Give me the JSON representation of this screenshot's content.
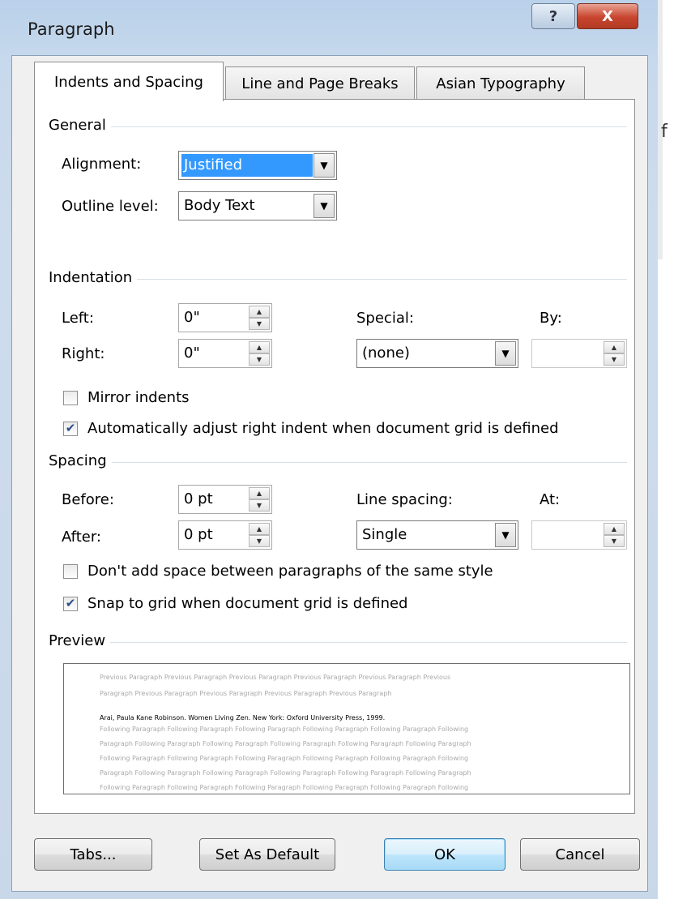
{
  "window": {
    "title": "Paragraph",
    "help_glyph": "?",
    "close_glyph": "X",
    "behind_text": "f"
  },
  "tabs": [
    {
      "label": "Indents and Spacing",
      "active": true
    },
    {
      "label": "Line and Page Breaks",
      "active": false
    },
    {
      "label": "Asian Typography",
      "active": false
    }
  ],
  "general": {
    "section_label": "General",
    "alignment_label": "Alignment:",
    "alignment_value": "Justified",
    "outline_label": "Outline level:",
    "outline_value": "Body Text"
  },
  "indentation": {
    "section_label": "Indentation",
    "left_label": "Left:",
    "left_value": "0\"",
    "right_label": "Right:",
    "right_value": "0\"",
    "special_label": "Special:",
    "special_value": "(none)",
    "by_label": "By:",
    "by_value": "",
    "mirror_label": "Mirror indents",
    "mirror_checked": false,
    "auto_adjust_label": "Automatically adjust right indent when document grid is defined",
    "auto_adjust_checked": true
  },
  "spacing": {
    "section_label": "Spacing",
    "before_label": "Before:",
    "before_value": "0 pt",
    "after_label": "After:",
    "after_value": "0 pt",
    "line_spacing_label": "Line spacing:",
    "line_spacing_value": "Single",
    "at_label": "At:",
    "at_value": "",
    "dont_add_label": "Don't add space between paragraphs of the same style",
    "dont_add_checked": false,
    "snap_label": "Snap to grid when document grid is defined",
    "snap_checked": true
  },
  "preview": {
    "section_label": "Preview",
    "previous_lines": [
      "Previous Paragraph Previous Paragraph Previous Paragraph Previous Paragraph Previous Paragraph Previous",
      "Paragraph Previous Paragraph Previous Paragraph Previous Paragraph Previous Paragraph"
    ],
    "current_line": "Arai, Paula Kane Robinson.  Women Living Zen.  New York:  Oxford University Press, 1999.",
    "following_lines": [
      "Following Paragraph Following Paragraph Following Paragraph Following Paragraph Following Paragraph Following",
      "Paragraph Following Paragraph Following Paragraph Following Paragraph Following Paragraph Following Paragraph",
      "Following Paragraph Following Paragraph Following Paragraph Following Paragraph Following Paragraph Following",
      "Paragraph Following Paragraph Following Paragraph Following Paragraph Following Paragraph Following Paragraph",
      "Following Paragraph Following Paragraph Following Paragraph Following Paragraph Following Paragraph Following"
    ]
  },
  "buttons": {
    "tabs": "Tabs...",
    "set_default": "Set As Default",
    "ok": "OK",
    "cancel": "Cancel"
  },
  "colors": {
    "selection": "#3399ff",
    "check": "#2b4e8c"
  }
}
